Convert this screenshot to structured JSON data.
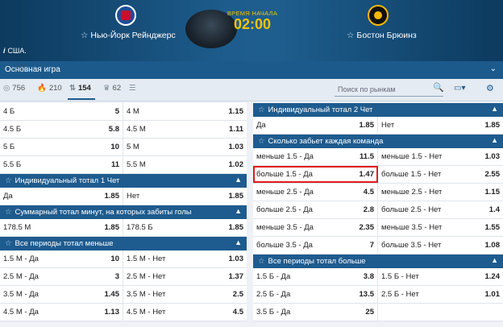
{
  "match": {
    "home_team": "Нью-Йорк Рейнджерс",
    "away_team": "Бостон Брюинз",
    "time_label": "ВРЕМЯ НАЧАЛА",
    "time_value": "02:00",
    "country": "США."
  },
  "main_bar": {
    "label": "Основная игра"
  },
  "filters": {
    "f1": "756",
    "f2": "210",
    "f3": "154",
    "f4": "62",
    "search_placeholder": "Поиск по рынкам"
  },
  "left": {
    "top_rows": [
      {
        "a": "4 Б",
        "ao": "5",
        "b": "4 М",
        "bo": "1.15"
      },
      {
        "a": "4.5 Б",
        "ao": "5.8",
        "b": "4.5 М",
        "bo": "1.11"
      },
      {
        "a": "5 Б",
        "ao": "10",
        "b": "5 М",
        "bo": "1.03"
      },
      {
        "a": "5.5 Б",
        "ao": "11",
        "b": "5.5 М",
        "bo": "1.02"
      }
    ],
    "ind_total_1": {
      "title": "Индивидуальный тотал 1 Чет",
      "rows": [
        {
          "a": "Да",
          "ao": "1.85",
          "b": "Нет",
          "bo": "1.85"
        }
      ]
    },
    "sum_total": {
      "title": "Суммарный тотал минут, на которых забиты голы",
      "rows": [
        {
          "a": "178.5 М",
          "ao": "1.85",
          "b": "178.5 Б",
          "bo": "1.85"
        }
      ]
    },
    "all_periods_less": {
      "title": "Все периоды тотал меньше",
      "rows": [
        {
          "a": "1.5 М - Да",
          "ao": "10",
          "b": "1.5 М - Нет",
          "bo": "1.03"
        },
        {
          "a": "2.5 М - Да",
          "ao": "3",
          "b": "2.5 М - Нет",
          "bo": "1.37"
        },
        {
          "a": "3.5 М - Да",
          "ao": "1.45",
          "b": "3.5 М - Нет",
          "bo": "2.5"
        },
        {
          "a": "4.5 М - Да",
          "ao": "1.13",
          "b": "4.5 М - Нет",
          "bo": "4.5"
        }
      ]
    }
  },
  "right": {
    "ind_total_2": {
      "title": "Индивидуальный тотал 2 Чет",
      "rows": [
        {
          "a": "Да",
          "ao": "1.85",
          "b": "Нет",
          "bo": "1.85"
        }
      ]
    },
    "each_team": {
      "title": "Сколько забьет каждая команда",
      "rows": [
        {
          "a": "меньше 1.5 - Да",
          "ao": "11.5",
          "b": "меньше 1.5 - Нет",
          "bo": "1.03"
        },
        {
          "a": "больше 1.5 - Да",
          "ao": "1.47",
          "b": "больше 1.5 - Нет",
          "bo": "2.55"
        },
        {
          "a": "меньше 2.5 - Да",
          "ao": "4.5",
          "b": "меньше 2.5 - Нет",
          "bo": "1.15"
        },
        {
          "a": "больше 2.5 - Да",
          "ao": "2.8",
          "b": "больше 2.5 - Нет",
          "bo": "1.4"
        },
        {
          "a": "меньше 3.5 - Да",
          "ao": "2.35",
          "b": "меньше 3.5 - Нет",
          "bo": "1.55"
        },
        {
          "a": "больше 3.5 - Да",
          "ao": "7",
          "b": "больше 3.5 - Нет",
          "bo": "1.08"
        }
      ]
    },
    "all_periods_more": {
      "title": "Все периоды тотал больше",
      "rows": [
        {
          "a": "1.5 Б - Да",
          "ao": "3.8",
          "b": "1.5 Б - Нет",
          "bo": "1.24"
        },
        {
          "a": "2.5 Б - Да",
          "ao": "13.5",
          "b": "2.5 Б - Нет",
          "bo": "1.01"
        },
        {
          "a": "3.5 Б - Да",
          "ao": "25",
          "b": "",
          "bo": ""
        }
      ]
    }
  },
  "colors": {
    "header": "#1e5b8e",
    "highlight": "#e01b1b"
  }
}
